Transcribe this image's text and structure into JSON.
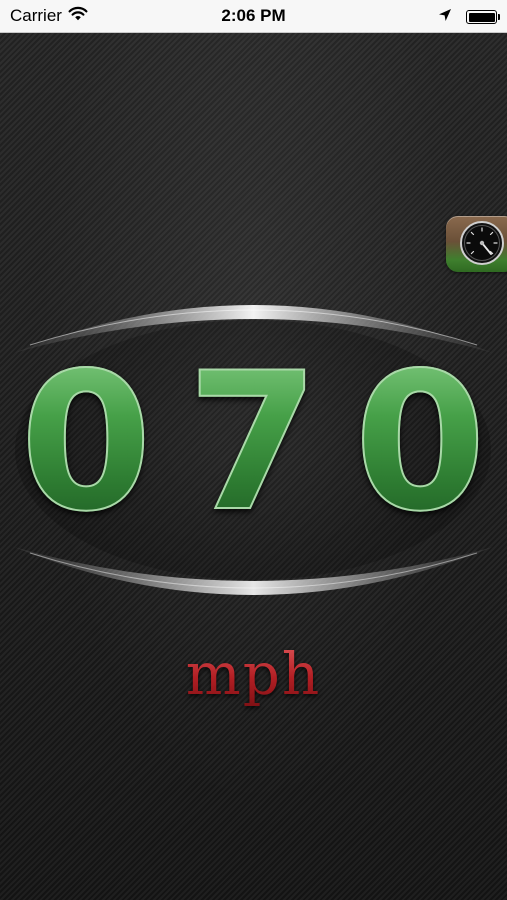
{
  "status_bar": {
    "carrier": "Carrier",
    "time": "2:06 PM",
    "battery_level": 1.0
  },
  "gauge_button": {
    "icon": "speedometer-icon"
  },
  "speed": {
    "digits": [
      "0",
      "7",
      "0"
    ],
    "unit": "mph"
  },
  "colors": {
    "digit_green": "#46a048",
    "unit_red": "#b21f24",
    "background": "#1f1f1f"
  }
}
